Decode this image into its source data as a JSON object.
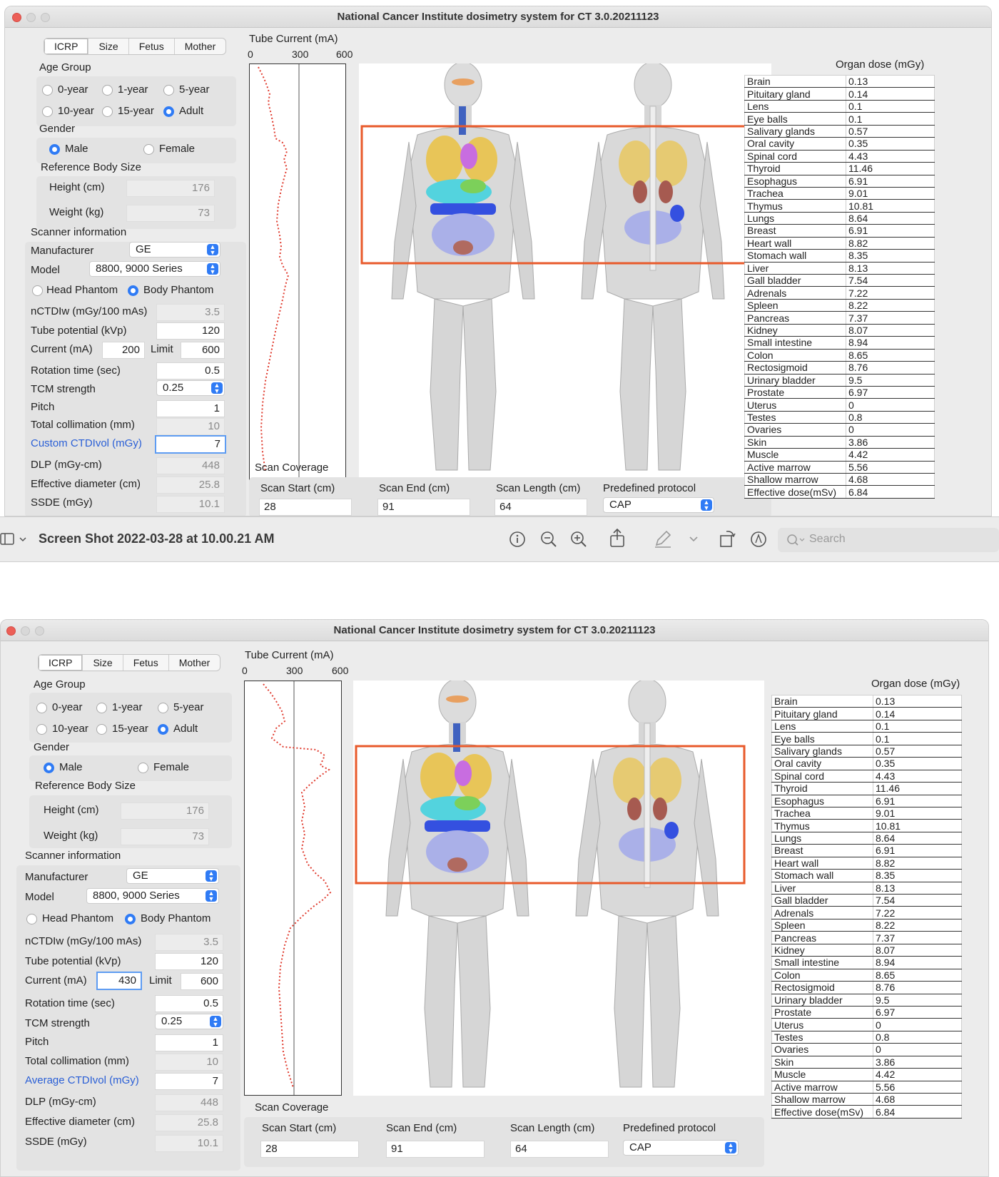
{
  "app_title": "National Cancer Institute dosimetry system for CT 3.0.20211123",
  "tabs": [
    "ICRP",
    "Size",
    "Fetus",
    "Mother"
  ],
  "age_group": {
    "label": "Age Group",
    "options": [
      "0-year",
      "1-year",
      "5-year",
      "10-year",
      "15-year",
      "Adult"
    ],
    "selected": "Adult"
  },
  "gender": {
    "label": "Gender",
    "male": "Male",
    "female": "Female",
    "selected": "Male"
  },
  "ref_body": {
    "label": "Reference Body Size",
    "height_label": "Height (cm)",
    "height": "176",
    "weight_label": "Weight (kg)",
    "weight": "73"
  },
  "scanner": {
    "title": "Scanner information",
    "manufacturer_label": "Manufacturer",
    "manufacturer": "GE",
    "model_label": "Model",
    "model": "8800, 9000 Series",
    "head_phantom": "Head Phantom",
    "body_phantom": "Body Phantom",
    "nctdi_label": "nCTDIw (mGy/100 mAs)",
    "nctdi": "3.5",
    "kvp_label": "Tube potential (kVp)",
    "kvp": "120",
    "current_label": "Current (mA)",
    "limit_label": "Limit",
    "limit": "600",
    "rotation_label": "Rotation time (sec)",
    "rotation": "0.5",
    "tcm_label": "TCM strength",
    "tcm": "0.25",
    "pitch_label": "Pitch",
    "pitch": "1",
    "collimation_label": "Total collimation (mm)",
    "collimation": "10",
    "dlp_label": "DLP (mGy-cm)",
    "dlp": "448",
    "eff_diam_label": "Effective diameter (cm)",
    "eff_diam": "25.8",
    "ssde_label": "SSDE (mGy)",
    "ssde": "10.1"
  },
  "windows": [
    {
      "current": "200",
      "ctdi_label": "Custom CTDIvol (mGy)",
      "ctdi": "7"
    },
    {
      "current": "430",
      "ctdi_label": "Average CTDIvol (mGy)",
      "ctdi": "7"
    }
  ],
  "tube_current": {
    "label": "Tube Current (mA)",
    "ticks": [
      "0",
      "300",
      "600"
    ]
  },
  "scan_coverage": {
    "label": "Scan Coverage",
    "start_label": "Scan Start (cm)",
    "start": "28",
    "end_label": "Scan End (cm)",
    "end": "91",
    "length_label": "Scan Length (cm)",
    "length": "64",
    "protocol_label": "Predefined protocol",
    "protocol": "CAP"
  },
  "organ_dose": {
    "label": "Organ dose (mGy)",
    "rows": [
      [
        "Brain",
        "0.13"
      ],
      [
        "Pituitary gland",
        "0.14"
      ],
      [
        "Lens",
        "0.1"
      ],
      [
        "Eye balls",
        "0.1"
      ],
      [
        "Salivary glands",
        "0.57"
      ],
      [
        "Oral cavity",
        "0.35"
      ],
      [
        "Spinal cord",
        "4.43"
      ],
      [
        "Thyroid",
        "11.46"
      ],
      [
        "Esophagus",
        "6.91"
      ],
      [
        "Trachea",
        "9.01"
      ],
      [
        "Thymus",
        "10.81"
      ],
      [
        "Lungs",
        "8.64"
      ],
      [
        "Breast",
        "6.91"
      ],
      [
        "Heart wall",
        "8.82"
      ],
      [
        "Stomach wall",
        "8.35"
      ],
      [
        "Liver",
        "8.13"
      ],
      [
        "Gall bladder",
        "7.54"
      ],
      [
        "Adrenals",
        "7.22"
      ],
      [
        "Spleen",
        "8.22"
      ],
      [
        "Pancreas",
        "7.37"
      ],
      [
        "Kidney",
        "8.07"
      ],
      [
        "Small intestine",
        "8.94"
      ],
      [
        "Colon",
        "8.65"
      ],
      [
        "Rectosigmoid",
        "8.76"
      ],
      [
        "Urinary bladder",
        "9.5"
      ],
      [
        "Prostate",
        "6.97"
      ],
      [
        "Uterus",
        "0"
      ],
      [
        "Testes",
        "0.8"
      ],
      [
        "Ovaries",
        "0"
      ],
      [
        "Skin",
        "3.86"
      ],
      [
        "Muscle",
        "4.42"
      ],
      [
        "Active marrow",
        "5.56"
      ],
      [
        "Shallow marrow",
        "4.68"
      ],
      [
        "Effective dose(mSv)",
        "6.84"
      ]
    ]
  },
  "preview_toolbar": {
    "title": "Screen Shot 2022-03-28 at 10.00.21 AM",
    "search_placeholder": "Search"
  },
  "colors": {
    "accent": "#2f7bf5",
    "scan_box": "#e85a2b",
    "curve": "#e03b2e",
    "custom_label": "#2a5fd6"
  }
}
